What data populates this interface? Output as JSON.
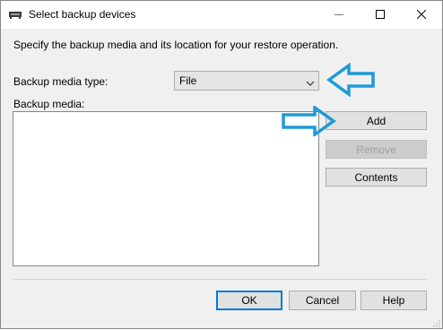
{
  "window": {
    "title": "Select backup devices",
    "icon": "backup-device-icon"
  },
  "titlebar_buttons": [
    "minimize-icon",
    "maximize-icon",
    "close-icon"
  ],
  "intro_text": "Specify the backup media and its location for your restore operation.",
  "media_type": {
    "label": "Backup media type:",
    "value": "File"
  },
  "backup_media": {
    "label": "Backup media:",
    "items": []
  },
  "buttons": {
    "add": "Add",
    "remove": "Remove",
    "contents": "Contents",
    "ok": "OK",
    "cancel": "Cancel",
    "help": "Help"
  },
  "colors": {
    "annotation_arrow": "#1e9bd7",
    "default_button_border": "#0078d7"
  }
}
